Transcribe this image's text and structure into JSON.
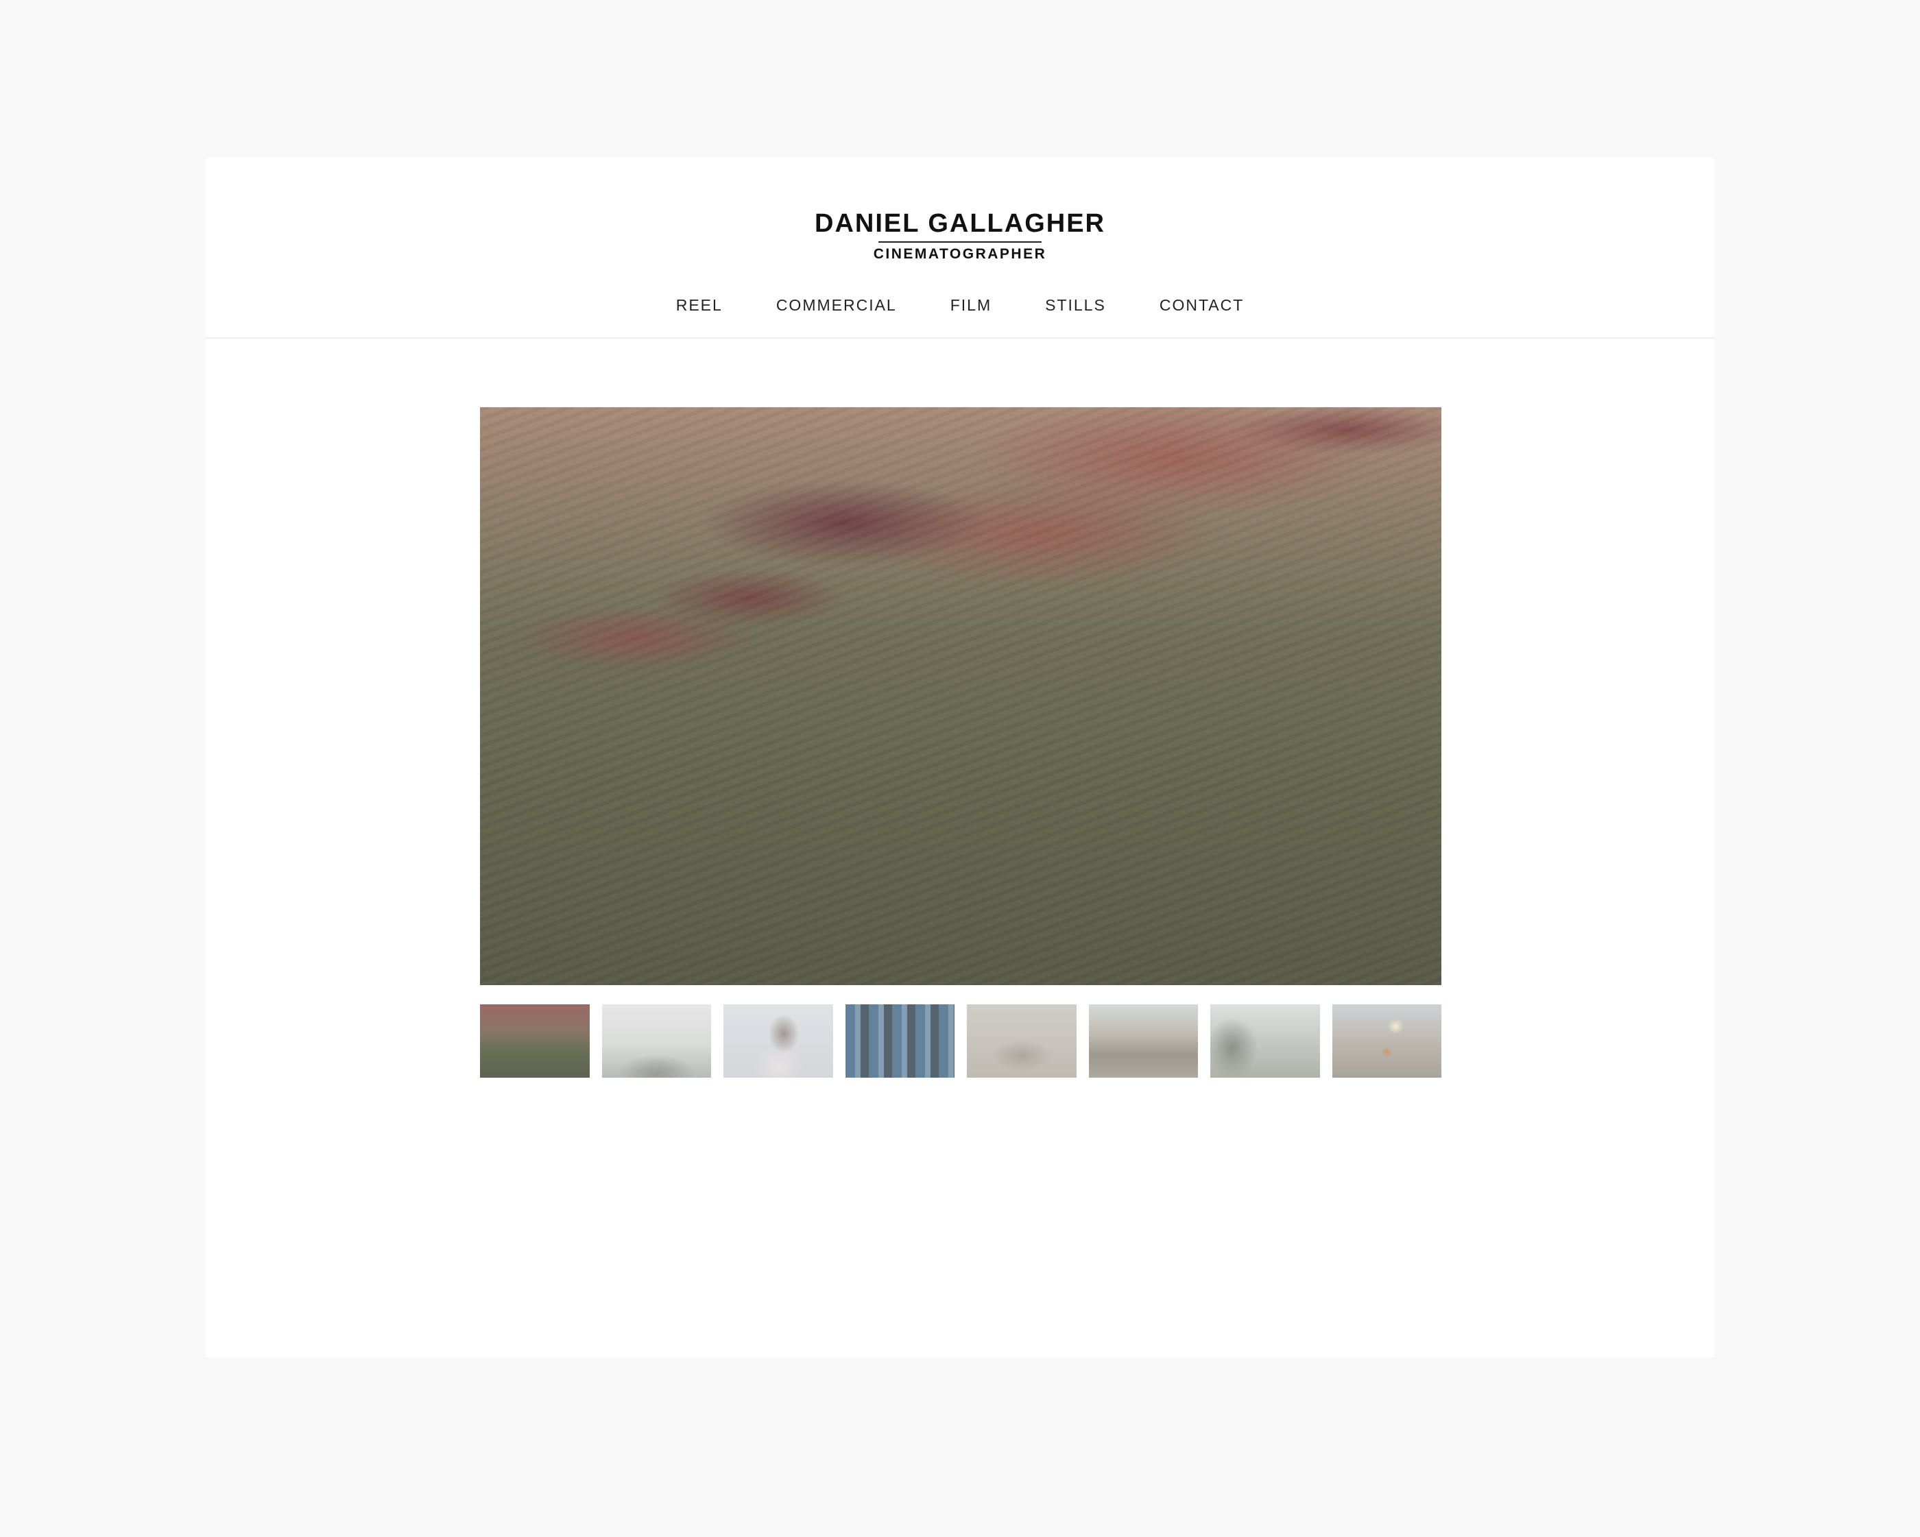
{
  "brand": {
    "name": "DANIEL GALLAGHER",
    "subtitle": "CINEMATOGRAPHER"
  },
  "nav": {
    "items": [
      "REEL",
      "COMMERCIAL",
      "FILM",
      "STILLS",
      "CONTACT"
    ]
  },
  "gallery": {
    "selected_index": 0,
    "thumbnail_count": 8
  }
}
